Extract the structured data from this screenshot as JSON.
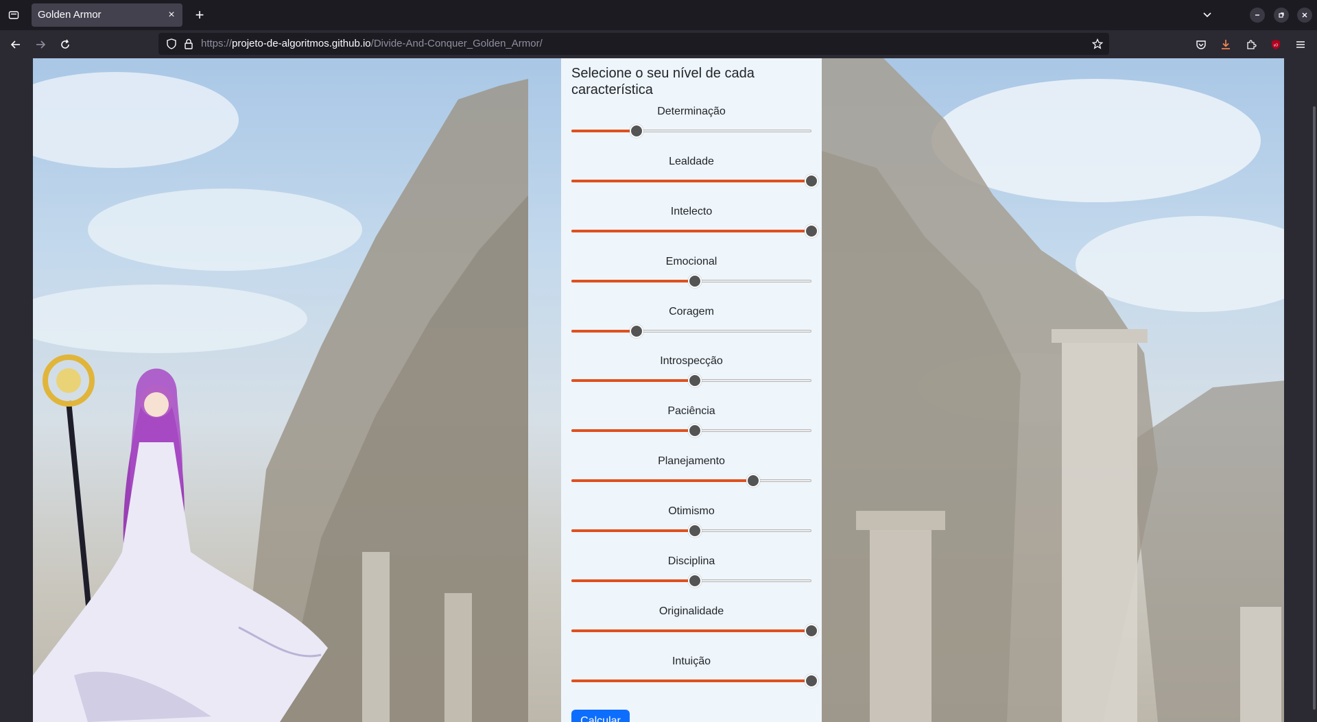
{
  "browser": {
    "tab_title": "Golden Armor",
    "tab_close": "×",
    "new_tab": "+",
    "url_scheme": "https://",
    "url_host": "projeto-de-algoritmos.github.io",
    "url_path": "/Divide-And-Conquer_Golden_Armor/",
    "icons": [
      "tab-list-icon",
      "back-arrow-icon",
      "forward-arrow-icon",
      "reload-icon",
      "tracking-shield-icon",
      "lock-icon",
      "bookmark-star-icon",
      "pocket-icon",
      "download-icon",
      "extensions-icon",
      "ublock-icon",
      "menu-icon",
      "chevron-down-icon",
      "minimize-icon",
      "restore-icon",
      "close-icon"
    ]
  },
  "panel": {
    "title": "Selecione o seu nível de cada característica",
    "sliders": [
      {
        "label": "Determinação",
        "value": 0.25
      },
      {
        "label": "Lealdade",
        "value": 1.0
      },
      {
        "label": "Intelecto",
        "value": 1.0
      },
      {
        "label": "Emocional",
        "value": 0.5
      },
      {
        "label": "Coragem",
        "value": 0.25
      },
      {
        "label": "Introspecção",
        "value": 0.5
      },
      {
        "label": "Paciência",
        "value": 0.5
      },
      {
        "label": "Planejamento",
        "value": 0.75
      },
      {
        "label": "Otimismo",
        "value": 0.5
      },
      {
        "label": "Disciplina",
        "value": 0.5
      },
      {
        "label": "Originalidade",
        "value": 1.0
      },
      {
        "label": "Intuição",
        "value": 1.0
      }
    ],
    "button_label": "Calcular"
  },
  "colors": {
    "accent": "#e0501e",
    "button": "#0d6efd",
    "panel_bg": "#eef5fb"
  }
}
